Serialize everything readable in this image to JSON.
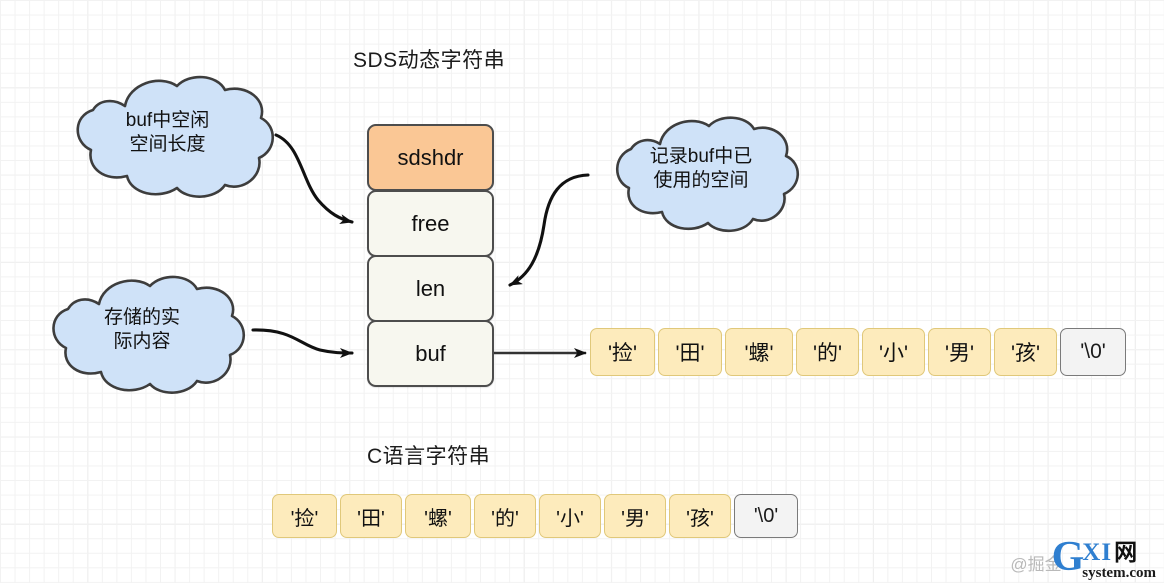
{
  "diagram": {
    "sds_title": "SDS动态字符串",
    "c_title": "C语言字符串"
  },
  "struct": {
    "fields": [
      {
        "label": "sdshdr",
        "fill": "#fac795",
        "type": "header"
      },
      {
        "label": "free",
        "fill": "#f7f7ef",
        "type": "field"
      },
      {
        "label": "len",
        "fill": "#f7f7ef",
        "type": "field"
      },
      {
        "label": "buf",
        "fill": "#f7f7ef",
        "type": "field"
      }
    ]
  },
  "clouds": [
    {
      "id": "free-note",
      "line1": "buf中空闲",
      "line2": "空间长度",
      "target": "free"
    },
    {
      "id": "buf-note",
      "line1": "存储的实",
      "line2": "际内容",
      "target": "buf"
    },
    {
      "id": "len-note",
      "line1": "记录buf中已",
      "line2": "使用的空间",
      "target": "len"
    }
  ],
  "sds_buffer": {
    "cells": [
      "'捡'",
      "'田'",
      "'螺'",
      "'的'",
      "'小'",
      "'男'",
      "'孩'",
      "'\\0'"
    ],
    "terminator_index": 7
  },
  "c_string": {
    "cells": [
      "'捡'",
      "'田'",
      "'螺'",
      "'的'",
      "'小'",
      "'男'",
      "'孩'",
      "'\\0'"
    ],
    "terminator_index": 7
  },
  "colors": {
    "header_fill": "#fac795",
    "field_fill": "#f7f7ef",
    "cell_fill": "#fdebbc",
    "cell_border": "#e0c87a",
    "nul_fill": "#f3f3f3",
    "nul_border": "#7a7a7a",
    "cloud_fill": "#cfe2f8",
    "cloud_border": "#3d3d3d",
    "stroke": "#4d4d4d",
    "watermark_blue": "#2f7fd0"
  },
  "watermark": {
    "source": "@掘金",
    "logo_g": "G",
    "logo_xi": "XI",
    "logo_wang": "网",
    "logo_domain": "system.com"
  }
}
